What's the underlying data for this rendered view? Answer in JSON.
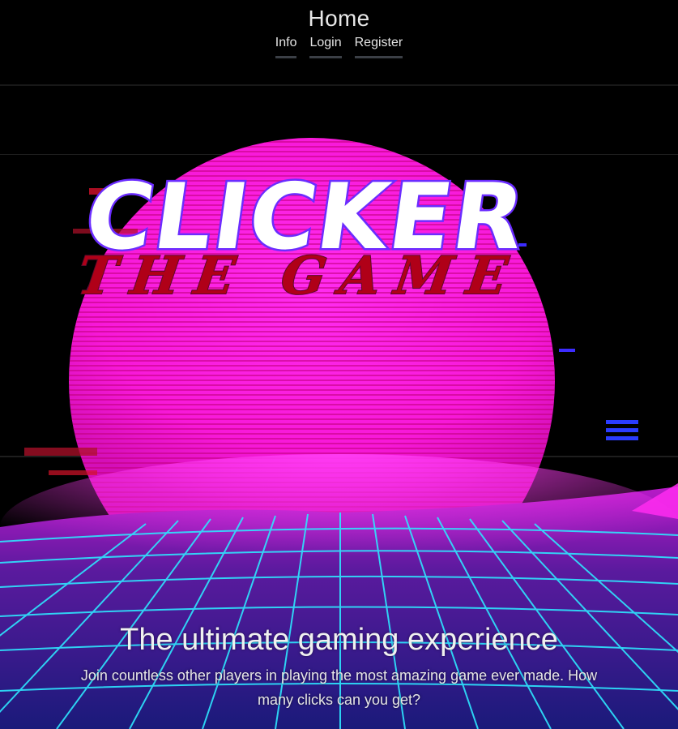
{
  "header": {
    "title": "Home",
    "nav": {
      "info": "Info",
      "login": "Login",
      "register": "Register"
    }
  },
  "logo": {
    "line1": "CLICKER",
    "line2": "THE GAME"
  },
  "hero": {
    "title": "The ultimate gaming experience",
    "text": "Join countless other players in playing the most amazing game ever made. How many clicks can you get?"
  },
  "colors": {
    "background": "#000000",
    "sun": "#ff1ee0",
    "grid": "#29e6ff",
    "logo_fill": "#ffffff",
    "logo_outline": "#6b2cff",
    "logo_subtitle": "#b00018",
    "nav_underline": "#3b3f46"
  }
}
